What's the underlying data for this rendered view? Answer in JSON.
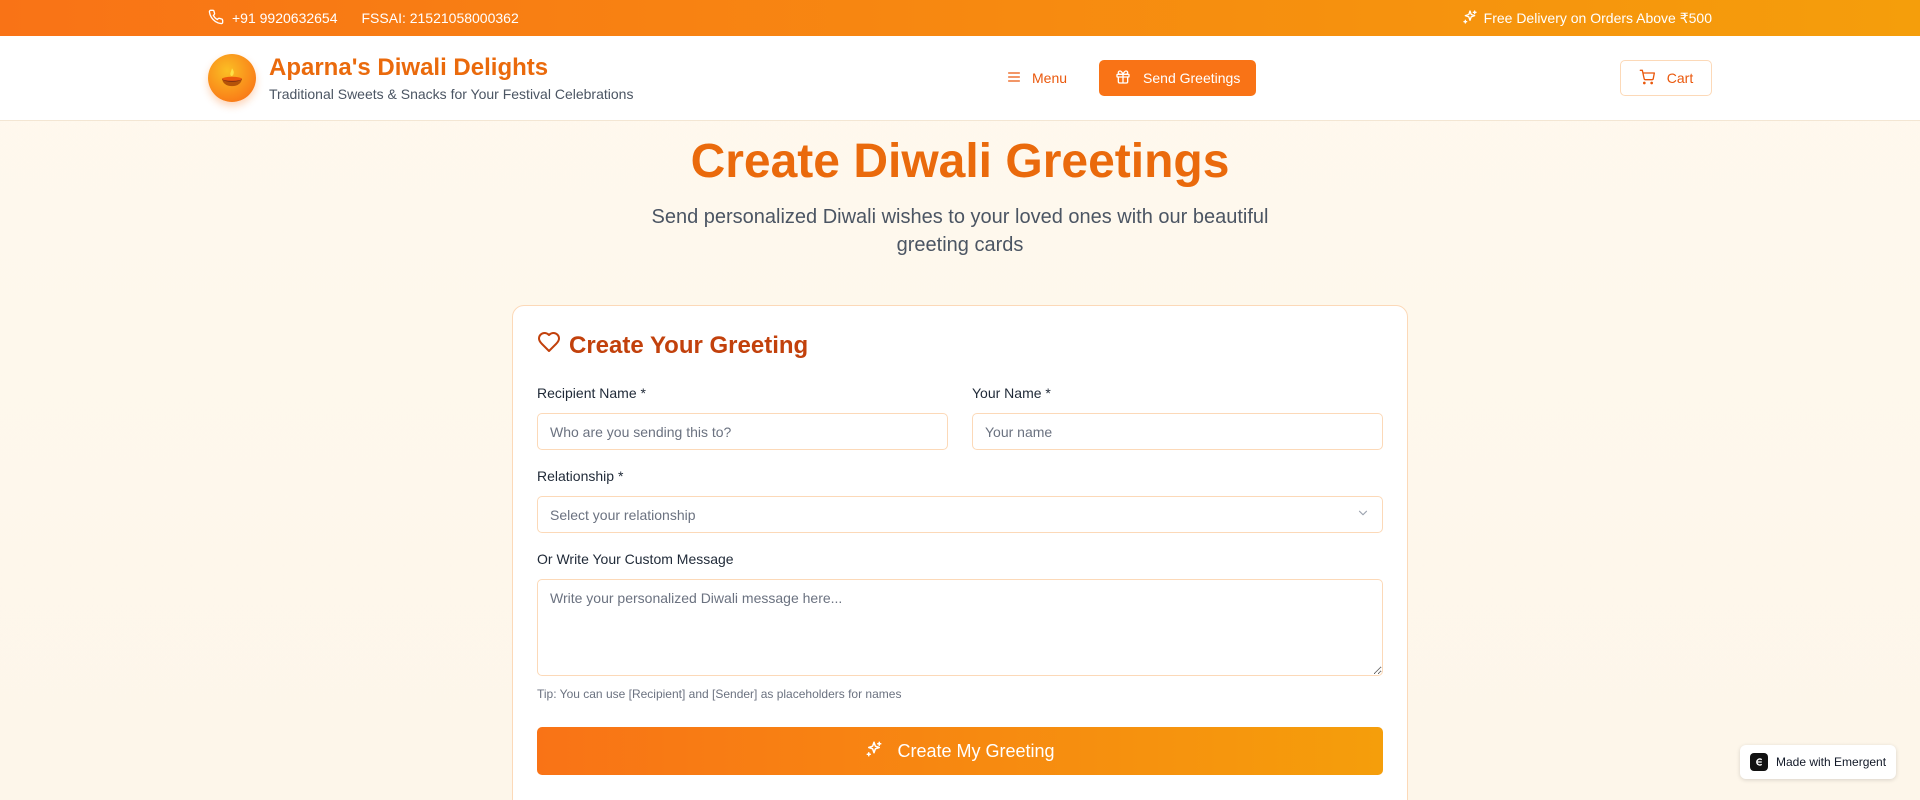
{
  "topbar": {
    "phone": "+91 9920632654",
    "fssai": "FSSAI: 21521058000362",
    "promo": "Free Delivery on Orders Above ₹500"
  },
  "header": {
    "brand_title": "Aparna's Diwali Delights",
    "brand_subtitle": "Traditional Sweets & Snacks for Your Festival Celebrations",
    "menu_label": "Menu",
    "greetings_label": "Send Greetings",
    "cart_label": "Cart"
  },
  "hero": {
    "title": "Create Diwali Greetings",
    "subtitle": "Send personalized Diwali wishes to your loved ones with our beautiful greeting cards"
  },
  "form": {
    "title": "Create Your Greeting",
    "recipient_label": "Recipient Name *",
    "recipient_placeholder": "Who are you sending this to?",
    "recipient_value": "",
    "sender_label": "Your Name *",
    "sender_placeholder": "Your name",
    "sender_value": "",
    "relationship_label": "Relationship *",
    "relationship_selected": "Select your relationship",
    "message_label": "Or Write Your Custom Message",
    "message_placeholder": "Write your personalized Diwali message here...",
    "message_value": "",
    "tip": "Tip: You can use [Recipient] and [Sender] as placeholders for names",
    "submit_label": "Create My Greeting"
  },
  "badge": {
    "label": "Made with Emergent"
  },
  "colors": {
    "accent": "#f97316",
    "accent_dark": "#ea6a0c",
    "title_dark": "#c2410c",
    "border": "#fcd9b8",
    "background": "#fff9ee"
  },
  "icons": {
    "phone": "phone-icon",
    "promo": "sparkles-icon",
    "logo": "diya-icon",
    "menu": "menu-icon",
    "greetings": "gift-icon",
    "cart": "cart-icon",
    "form_title": "heart-icon",
    "select": "chevron-down-icon",
    "submit": "sparkles-icon"
  }
}
